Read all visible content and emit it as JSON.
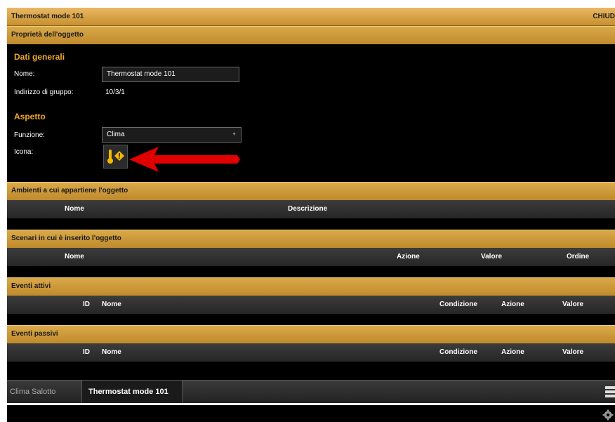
{
  "window": {
    "title": "Thermostat mode 101",
    "close_label": "CHIUD"
  },
  "properties": {
    "header": "Proprietà dell'oggetto",
    "general": {
      "title": "Dati generali",
      "name_label": "Nome:",
      "name_value": "Thermostat mode 101",
      "group_address_label": "Indirizzo di gruppo:",
      "group_address_value": "10/3/1"
    },
    "appearance": {
      "title": "Aspetto",
      "function_label": "Funzione:",
      "function_value": "Clima",
      "icon_label": "Icona:",
      "icon_name": "thermometer-warning-icon"
    }
  },
  "rooms": {
    "header": "Ambienti a cui appartiene l'oggetto",
    "columns": [
      "Nome",
      "Descrizione"
    ]
  },
  "scenes": {
    "header": "Scenari in cui è inserito l'oggetto",
    "columns": [
      "Nome",
      "Azione",
      "Valore",
      "Ordine"
    ]
  },
  "active_events": {
    "header": "Eventi attivi",
    "columns": [
      "ID",
      "Nome",
      "Condizione",
      "Azione",
      "Valore"
    ]
  },
  "passive_events": {
    "header": "Eventi passivi",
    "columns": [
      "ID",
      "Nome",
      "Condizione",
      "Azione",
      "Valore"
    ]
  },
  "bottom_tabs": {
    "inactive": "Clima Salotto",
    "active": "Thermostat mode 101"
  },
  "colors": {
    "accent": "#f0a82c",
    "section_bar": "#d9a94a",
    "arrow": "#e00000",
    "icon_yellow": "#f5b800"
  }
}
